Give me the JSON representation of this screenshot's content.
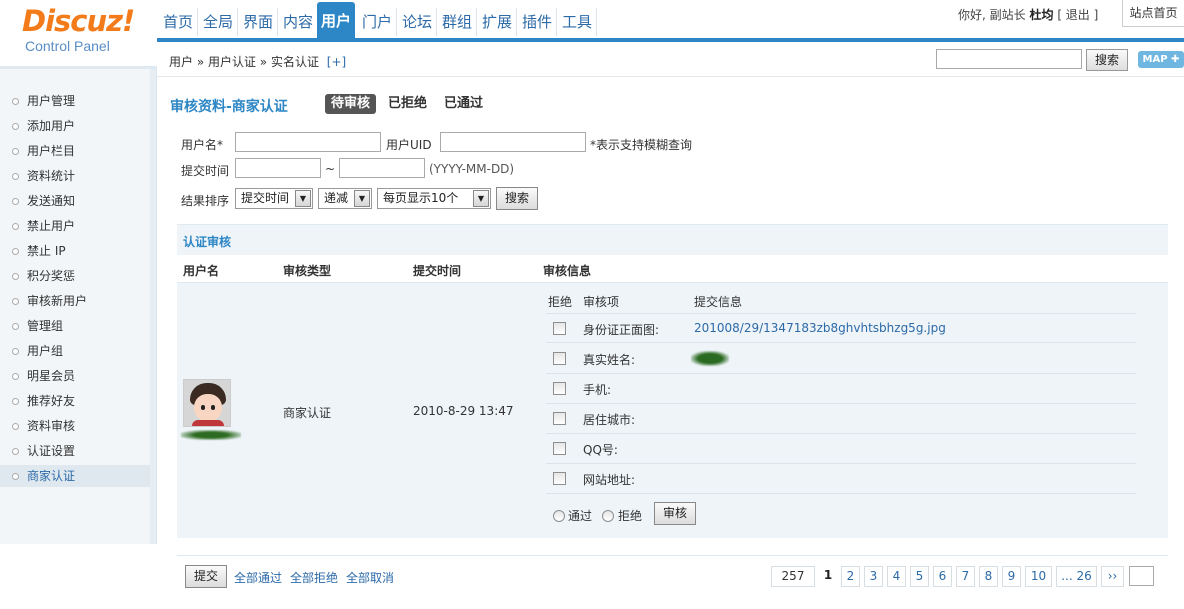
{
  "header": {
    "logo": "Discuz!",
    "logo_sub": "Control Panel",
    "nav": [
      "首页",
      "全局",
      "界面",
      "内容",
      "用户",
      "门户",
      "论坛",
      "群组",
      "扩展",
      "插件",
      "工具"
    ],
    "active_nav": "用户",
    "greeting_prefix": "你好, 副站长",
    "greeting_user": "杜均",
    "logout": "[ 退出 ]",
    "site_home": "站点首页"
  },
  "breadcrumb": {
    "text": "用户 » 用户认证 » 实名认证",
    "plus": "[+]",
    "search_button": "搜索",
    "map_button": "MAP ✚"
  },
  "sidebar": {
    "items": [
      "用户管理",
      "添加用户",
      "用户栏目",
      "资料统计",
      "发送通知",
      "禁止用户",
      "禁止 IP",
      "积分奖惩",
      "审核新用户",
      "管理组",
      "用户组",
      "明星会员",
      "推荐好友",
      "资料审核",
      "认证设置",
      "商家认证"
    ],
    "active": "商家认证"
  },
  "page": {
    "title": "审核资料-商家认证",
    "tabs": [
      "待审核",
      "已拒绝",
      "已通过"
    ],
    "active_tab": "待审核"
  },
  "filters": {
    "username_label": "用户名*",
    "uid_label": "用户UID",
    "fuzzy_note": "*表示支持模糊查询",
    "submit_time_label": "提交时间",
    "tilde": "~",
    "date_hint": "(YYYY-MM-DD)",
    "sort_label": "结果排序",
    "sort_field": "提交时间",
    "sort_order": "递减",
    "per_page": "每页显示10个",
    "search_button": "搜索"
  },
  "panel": {
    "title": "认证审核",
    "columns": [
      "用户名",
      "审核类型",
      "提交时间",
      "审核信息"
    ],
    "row": {
      "type": "商家认证",
      "submit_time": "2010-8-29 13:47"
    },
    "sub_columns": [
      "拒绝",
      "审核项",
      "提交信息"
    ],
    "items": [
      {
        "label": "身份证正面图:",
        "value": "201008/29/1347183zb8ghvhtsbhzg5g.jpg"
      },
      {
        "label": "真实姓名:",
        "value": ""
      },
      {
        "label": "手机:",
        "value": ""
      },
      {
        "label": "居住城市:",
        "value": ""
      },
      {
        "label": "QQ号:",
        "value": ""
      },
      {
        "label": "网站地址:",
        "value": ""
      }
    ],
    "radio_pass": "通过",
    "radio_reject": "拒绝",
    "review_button": "审核"
  },
  "footer": {
    "submit_button": "提交",
    "links": [
      "全部通过",
      "全部拒绝",
      "全部取消"
    ],
    "pagination": {
      "total": "257",
      "current": "1",
      "pages": [
        "2",
        "3",
        "4",
        "5",
        "6",
        "7",
        "8",
        "9",
        "10",
        "... 26",
        "››"
      ]
    }
  }
}
